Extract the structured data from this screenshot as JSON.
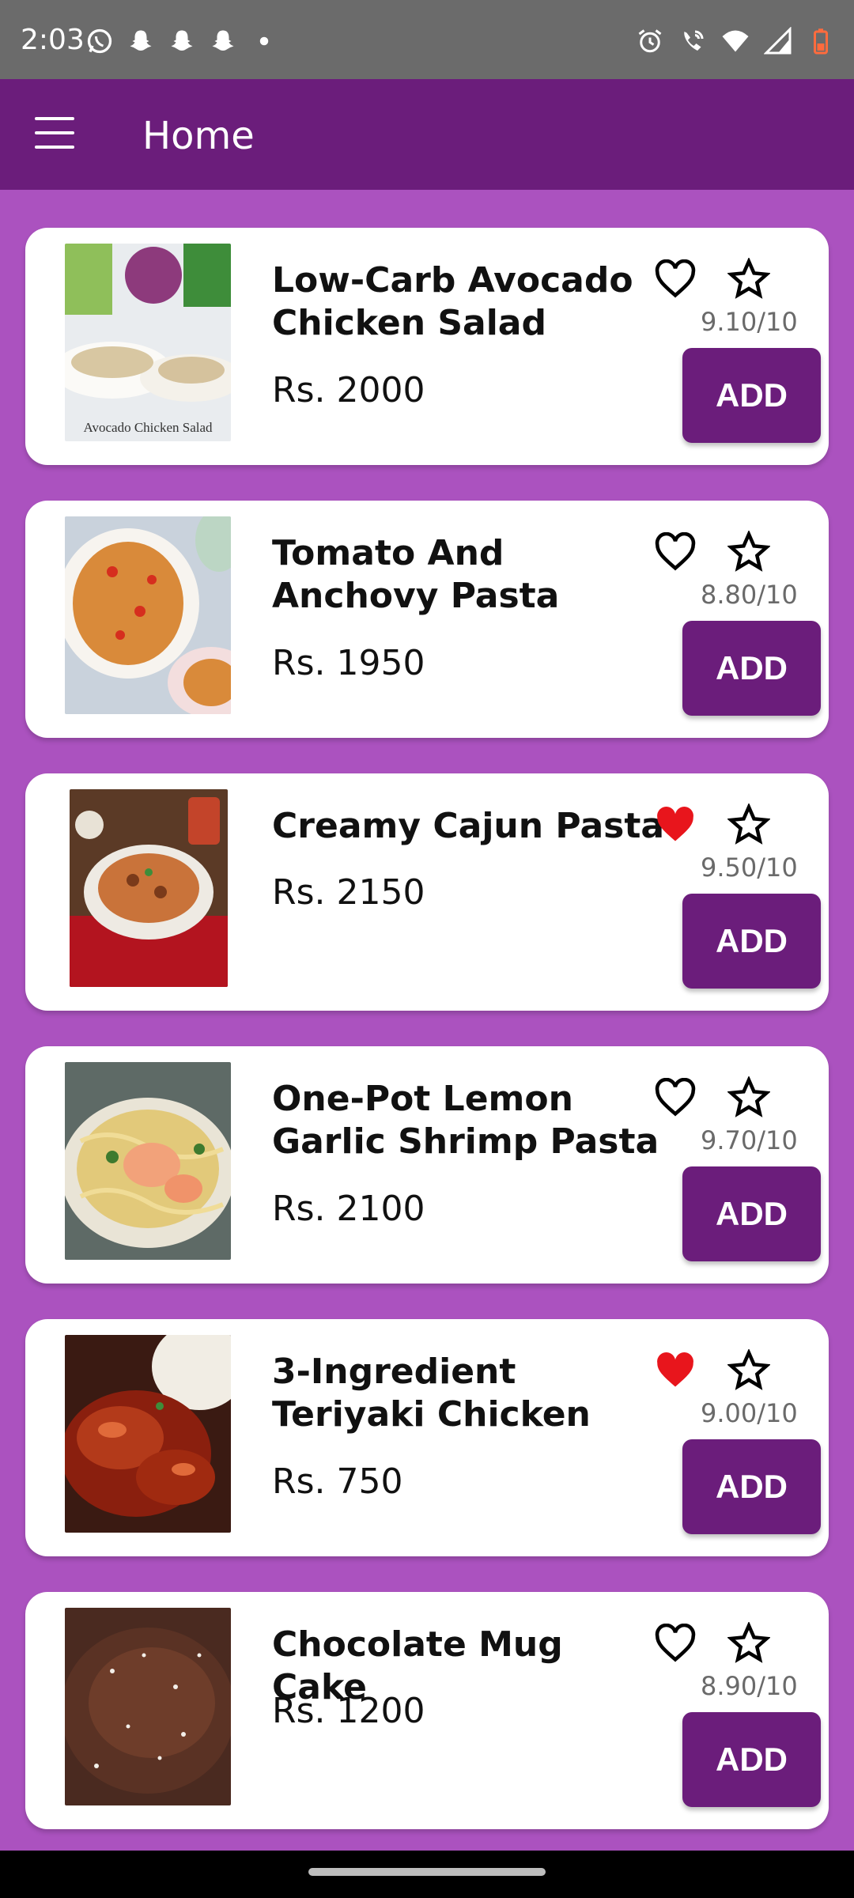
{
  "status_bar": {
    "time": "2:03",
    "left_icons": [
      "whatsapp-icon",
      "snapchat-icon",
      "snapchat-icon",
      "snapchat-icon",
      "dot-icon"
    ],
    "right_icons": [
      "alarm-icon",
      "wifi-call-icon",
      "wifi-icon",
      "signal-icon",
      "battery-low-icon"
    ]
  },
  "app_bar": {
    "title": "Home",
    "menu_icon": "hamburger-menu-icon"
  },
  "colors": {
    "app_bar": "#6b1d7b",
    "background": "#ab52bf",
    "button": "#6b1d7b",
    "favorite_active": "#e8151c",
    "status_bar": "#6b6b6b"
  },
  "foods": [
    {
      "name": "Low-Carb Avocado Chicken Salad",
      "price": "Rs. 2000",
      "rating": "9.10/10",
      "favorite": false,
      "add_label": "ADD",
      "image_caption": "Avocado Chicken Salad"
    },
    {
      "name": "Tomato And Anchovy Pasta",
      "price": "Rs. 1950",
      "rating": "8.80/10",
      "favorite": false,
      "add_label": "ADD"
    },
    {
      "name": "Creamy Cajun Pasta",
      "price": "Rs. 2150",
      "rating": "9.50/10",
      "favorite": true,
      "add_label": "ADD"
    },
    {
      "name": "One-Pot Lemon Garlic Shrimp Pasta",
      "price": "Rs. 2100",
      "rating": "9.70/10",
      "favorite": false,
      "add_label": "ADD"
    },
    {
      "name": "3-Ingredient Teriyaki Chicken",
      "price": "Rs. 750",
      "rating": "9.00/10",
      "favorite": true,
      "add_label": "ADD"
    },
    {
      "name": "Chocolate Mug Cake",
      "price": "Rs. 1200",
      "rating": "8.90/10",
      "favorite": false,
      "add_label": "ADD"
    }
  ]
}
